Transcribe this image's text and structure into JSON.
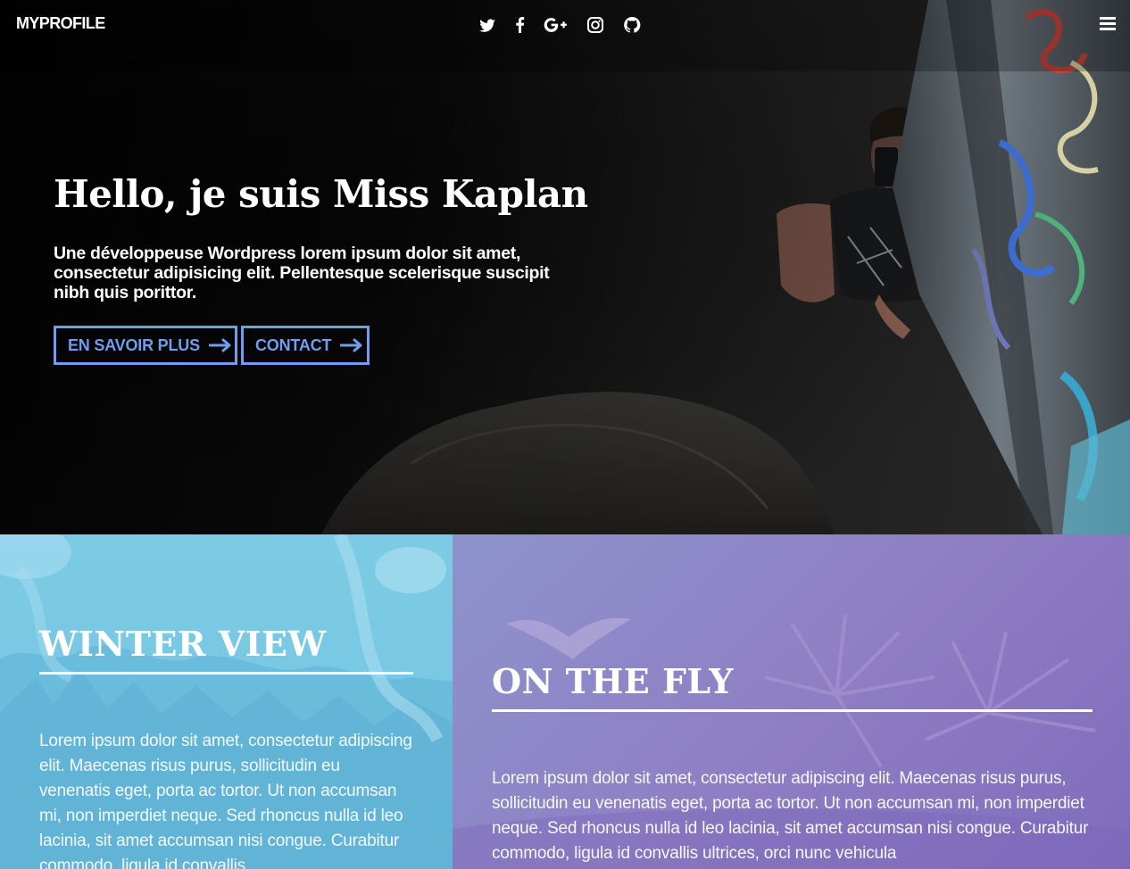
{
  "navbar": {
    "brand": "MYPROFILE",
    "social_icons": [
      "twitter-icon",
      "facebook-icon",
      "google-plus-icon",
      "instagram-icon",
      "github-icon"
    ],
    "menu_icon": "hamburger-menu-icon"
  },
  "hero": {
    "title": "Hello, je suis Miss Kaplan",
    "subtitle": "Une développeuse Wordpress lorem ipsum dolor sit amet, consectetur adipisicing elit. Pellentesque scelerisque suscipit nibh quis porittor.",
    "buttons": [
      {
        "label": "EN SAVOIR PLUS",
        "icon": "arrow-right-icon"
      },
      {
        "label": "CONTACT",
        "icon": "arrow-right-icon"
      }
    ]
  },
  "cards": [
    {
      "title": "WINTER VIEW",
      "text": "Lorem ipsum dolor sit amet, consectetur adipiscing elit. Maecenas risus purus, sollicitudin eu venenatis eget, porta ac tortor. Ut non accumsan mi, non imperdiet neque. Sed rhoncus nulla id leo lacinia, sit amet accumsan nisi congue. Curabitur commodo, ligula id convallis"
    },
    {
      "title": "ON THE FLY",
      "text": "Lorem ipsum dolor sit amet, consectetur adipiscing elit. Maecenas risus purus, sollicitudin eu venenatis eget, porta ac tortor. Ut non accumsan mi, non imperdiet neque. Sed rhoncus nulla id leo lacinia, sit amet accumsan nisi congue. Curabitur commodo, ligula id convallis ultrices, orci nunc vehicula"
    }
  ],
  "colors": {
    "accent": "#6e9df1",
    "winter_overlay": "#7ccbe5",
    "fly_overlay": "#8f7fc4"
  }
}
